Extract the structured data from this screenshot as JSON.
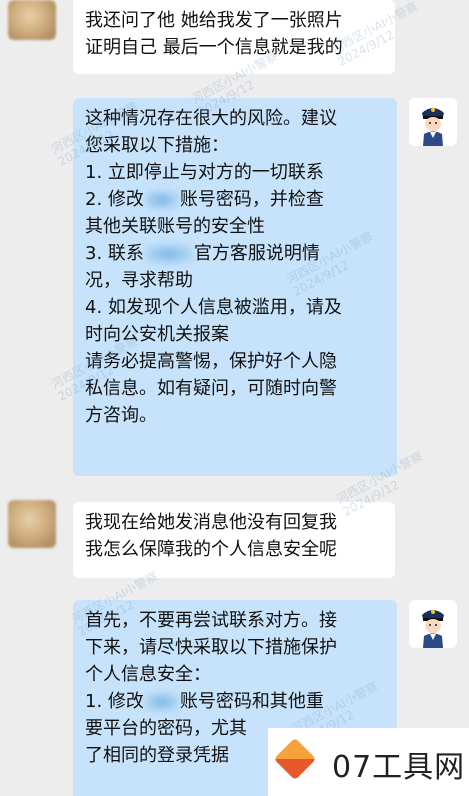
{
  "messages": [
    {
      "sender": "user",
      "lines": [
        "我还问了他 她给我发了一张照片",
        "证明自己 最后一个信息就是我的"
      ]
    },
    {
      "sender": "bot",
      "lines": [
        "这种情况存在很大的风险。建议",
        "您采取以下措施：",
        "1. 立即停止与对方的一切联系",
        [
          "2. 修改",
          "账号密码，并检查"
        ],
        "其他关联账号的安全性",
        [
          "3. 联系",
          "官方客服说明情"
        ],
        "况，寻求帮助",
        "4. 如发现个人信息被滥用，请及",
        "时向公安机关报案",
        "请务必提高警惕，保护好个人隐",
        "私信息。如有疑问，可随时向警",
        "方咨询。"
      ]
    },
    {
      "sender": "user",
      "lines": [
        "我现在给她发消息他没有回复我",
        "我怎么保障我的个人信息安全呢"
      ]
    },
    {
      "sender": "bot",
      "lines": [
        "首先，不要再尝试联系对方。接",
        "下来，请尽快采取以下措施保护",
        "个人信息安全：",
        [
          "1. 修改",
          "账号密码和其他重"
        ],
        "要平台的密码，尤其",
        "了相同的登录凭据"
      ]
    }
  ],
  "watermark": {
    "line1": "河西区小AI小警察",
    "line2": "2024/9/12"
  },
  "site_logo": {
    "text": "07工具网"
  }
}
